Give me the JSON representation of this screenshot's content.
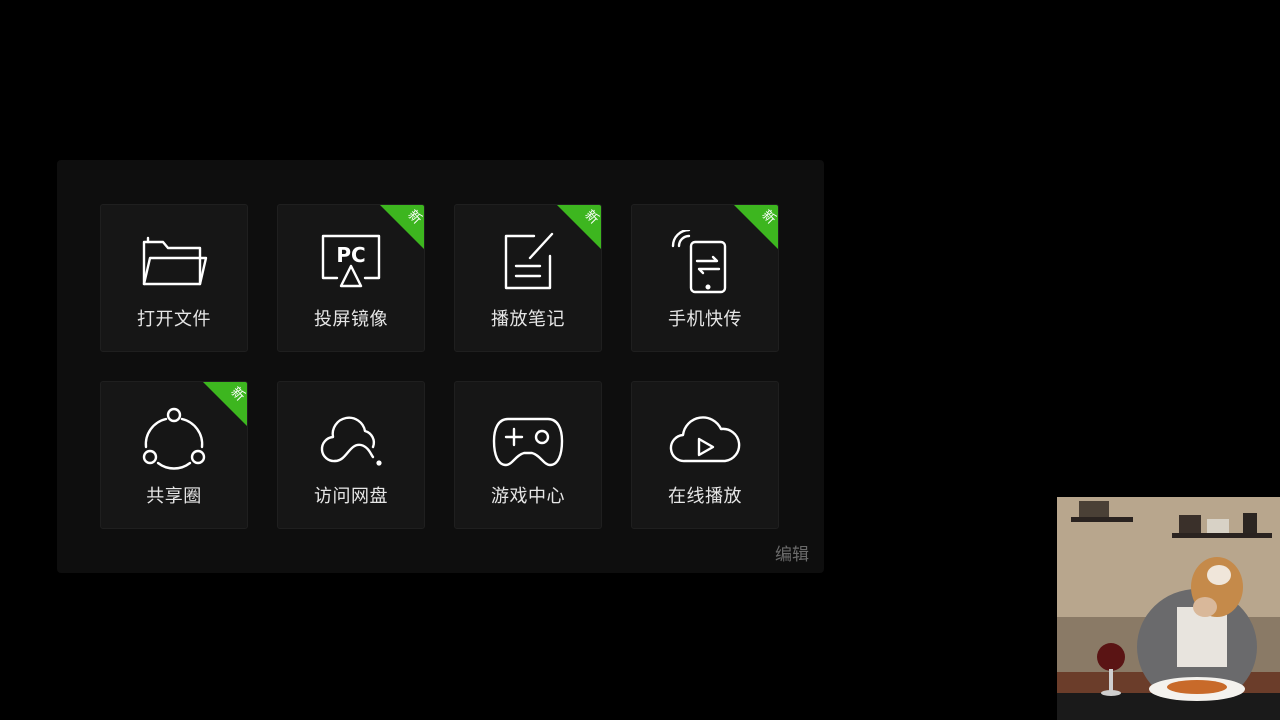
{
  "menu": {
    "tiles": [
      {
        "label": "打开文件",
        "icon": "folder-icon",
        "badge": ""
      },
      {
        "label": "投屏镜像",
        "icon": "pc-cast-icon",
        "badge": "新"
      },
      {
        "label": "播放笔记",
        "icon": "note-icon",
        "badge": "新"
      },
      {
        "label": "手机快传",
        "icon": "phone-transfer-icon",
        "badge": "新"
      },
      {
        "label": "共享圈",
        "icon": "share-circle-icon",
        "badge": "新"
      },
      {
        "label": "访问网盘",
        "icon": "cloud-drive-icon",
        "badge": ""
      },
      {
        "label": "游戏中心",
        "icon": "gamepad-icon",
        "badge": ""
      },
      {
        "label": "在线播放",
        "icon": "cloud-play-icon",
        "badge": ""
      }
    ],
    "edit_label": "编辑",
    "pc_text": "PC"
  },
  "colors": {
    "background": "#000000",
    "panel": "#0e0e0e",
    "tile": "#161616",
    "badge": "#3db61f",
    "label": "#e6e6e6",
    "edit": "#6a6a6a"
  }
}
